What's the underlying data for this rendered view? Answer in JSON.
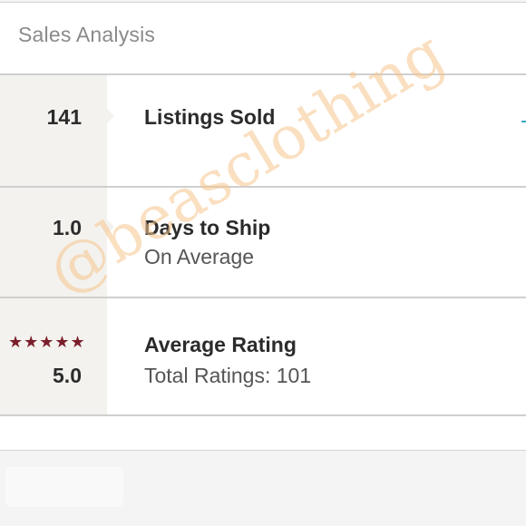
{
  "card": {
    "title": "Sales Analysis"
  },
  "stats": [
    {
      "value": "141",
      "title": "Listings Sold",
      "subtitle": ""
    },
    {
      "value": "1.0",
      "title": "Days to Ship",
      "subtitle": "On Average"
    },
    {
      "value": "5.0",
      "title": "Average Rating",
      "subtitle": "Total Ratings: 101",
      "stars": "★★★★★",
      "rating_out_of_5": 5
    }
  ],
  "watermark": "@beasclothing",
  "colors": {
    "star": "#7a1f2b",
    "watermark": "#f5c48c",
    "accent": "#3aa6c9"
  }
}
